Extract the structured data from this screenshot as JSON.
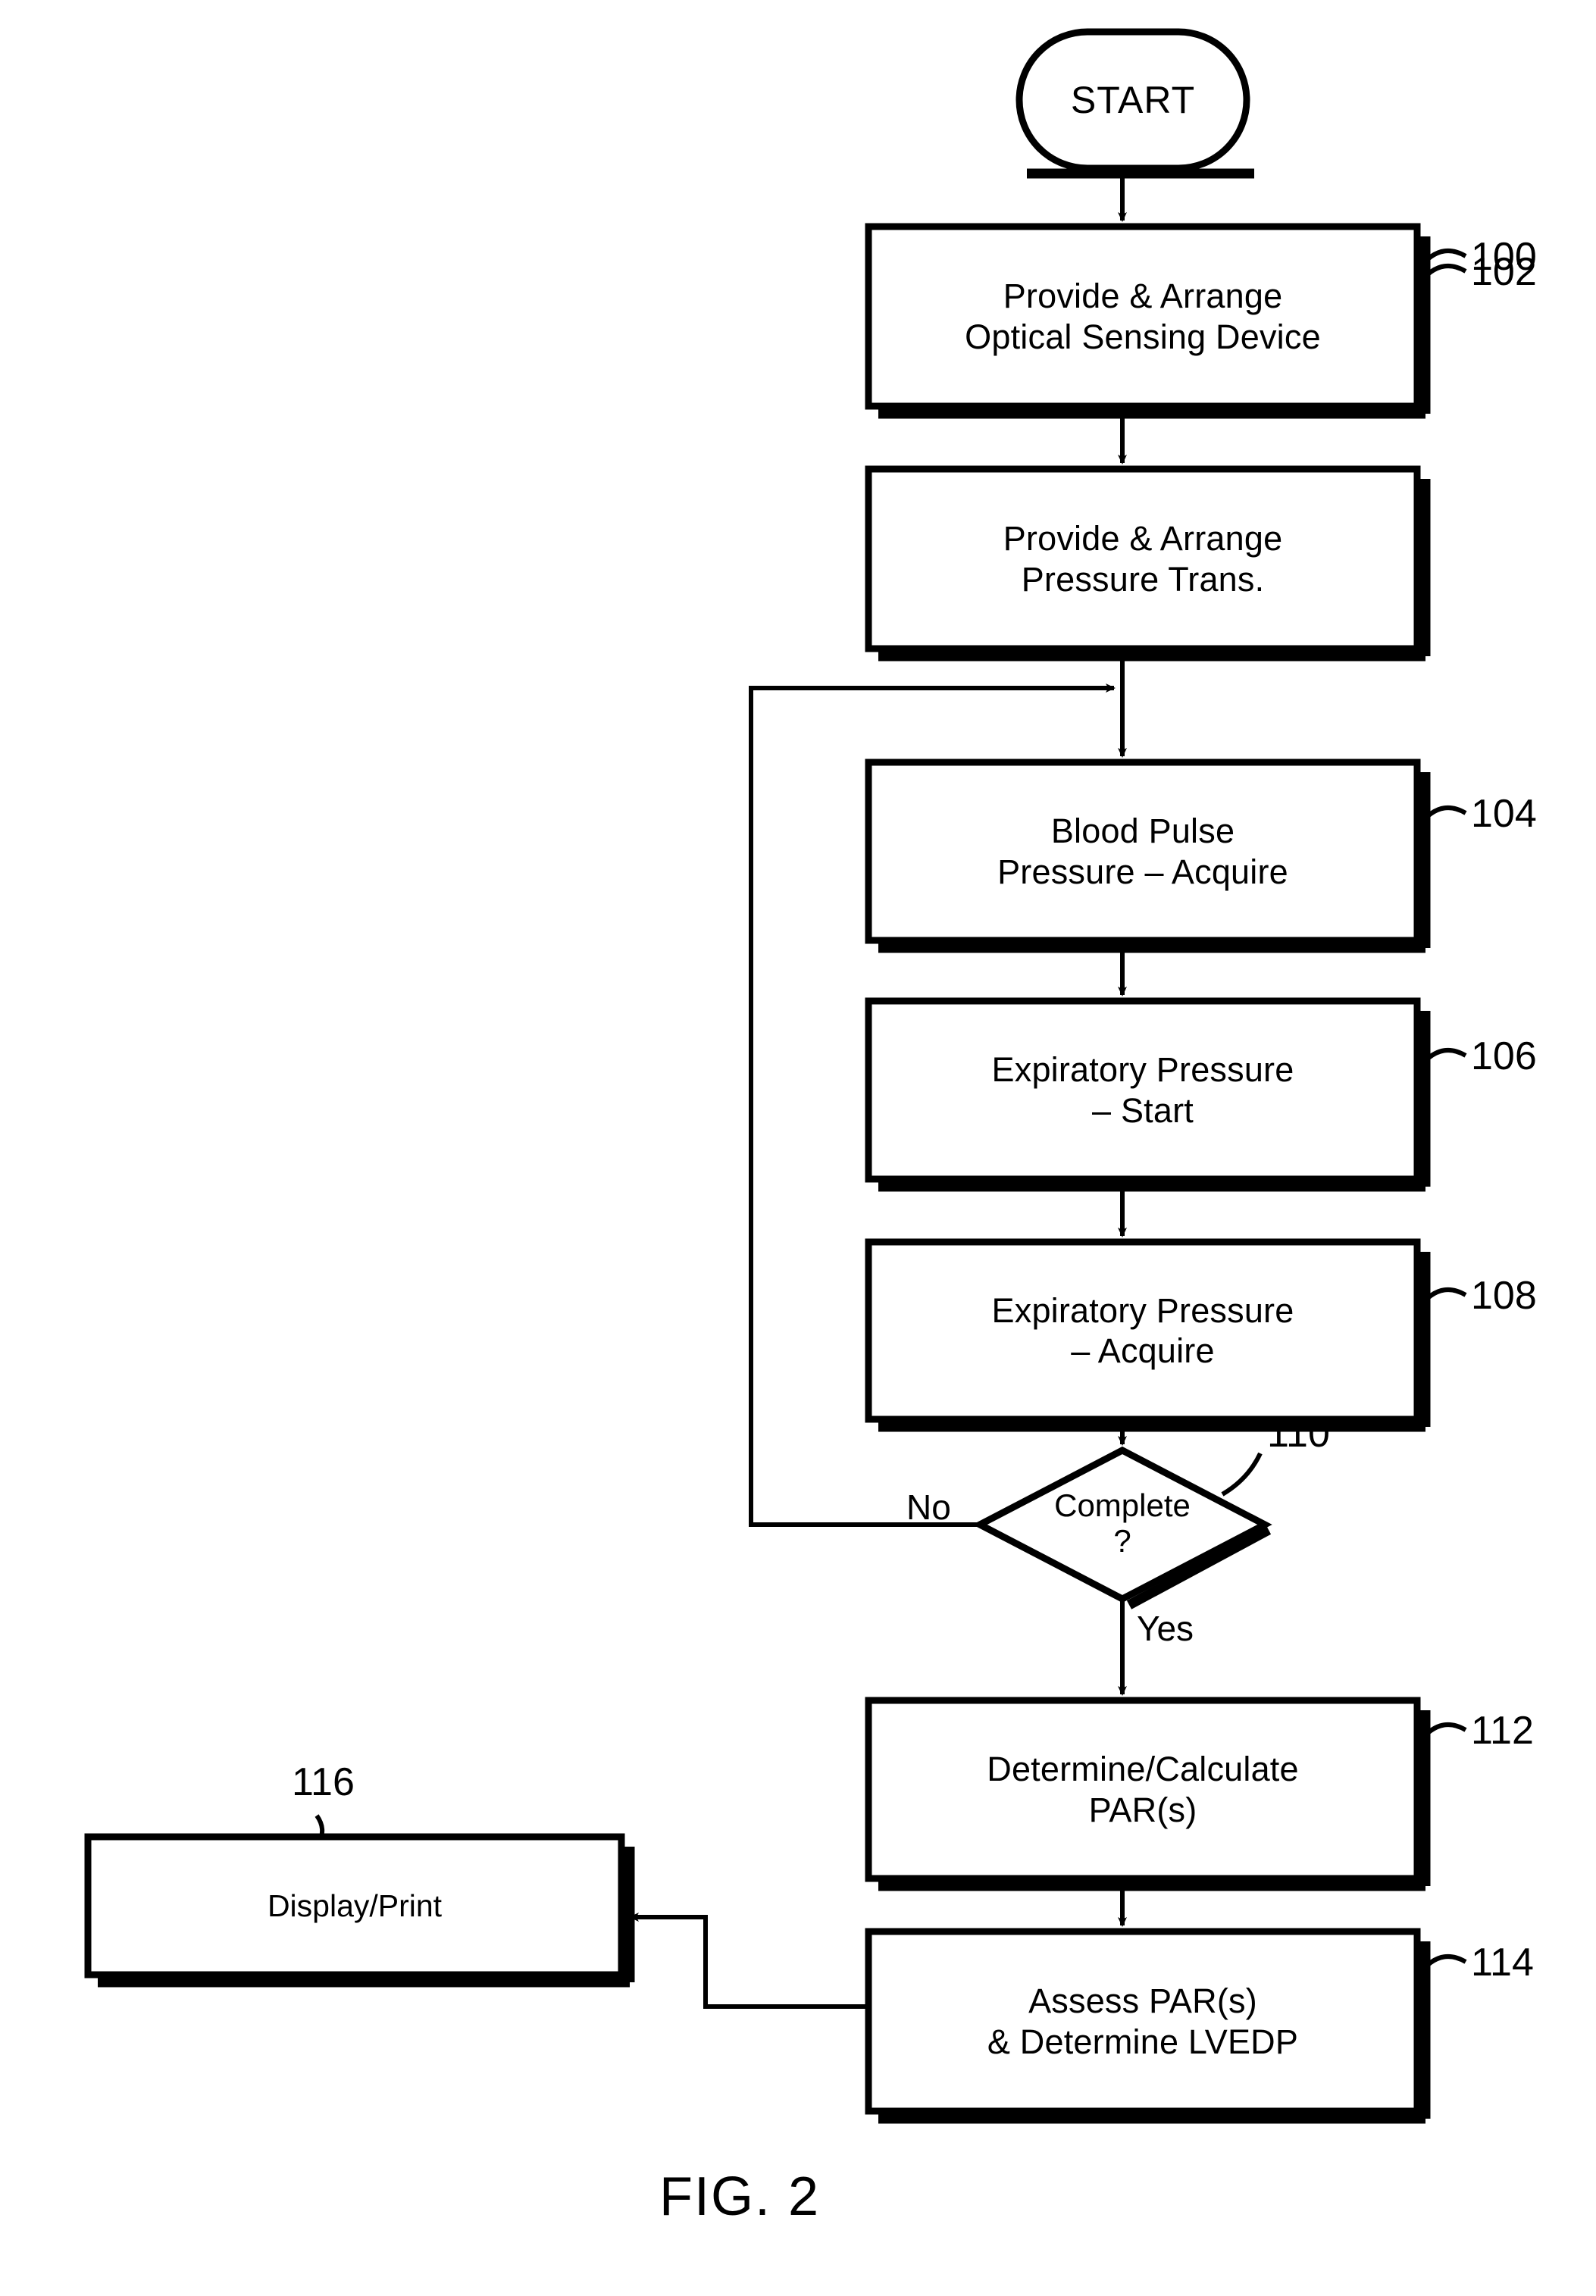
{
  "figure": {
    "caption": "FIG. 2",
    "type": "patent-flowchart"
  },
  "nodes": {
    "start": {
      "shape": "stadium",
      "label": "START"
    },
    "step_100": {
      "shape": "process",
      "ref": "100",
      "line1": "Provide & Arrange",
      "line2": "Optical Sensing Device"
    },
    "step_102": {
      "shape": "process",
      "ref": "102",
      "line1": "Provide & Arrange",
      "line2": "Pressure Trans."
    },
    "step_104": {
      "shape": "process",
      "ref": "104",
      "line1": "Blood Pulse",
      "line2": "Pressure – Acquire"
    },
    "step_106": {
      "shape": "process",
      "ref": "106",
      "line1": "Expiratory Pressure",
      "line2": "– Start"
    },
    "step_108": {
      "shape": "process",
      "ref": "108",
      "line1": "Expiratory Pressure",
      "line2": "– Acquire"
    },
    "decision_110": {
      "shape": "diamond",
      "ref": "110",
      "line1": "Complete",
      "line2": "?",
      "branch_no": "No",
      "branch_yes": "Yes"
    },
    "step_112": {
      "shape": "process",
      "ref": "112",
      "line1": "Determine/Calculate",
      "line2": "PAR(s)"
    },
    "step_114": {
      "shape": "process",
      "ref": "114",
      "line1": "Assess PAR(s)",
      "line2": "& Determine LVEDP"
    },
    "step_116": {
      "shape": "process",
      "ref": "116",
      "line1": "Display/Print"
    }
  },
  "colors": {
    "stroke": "#000000",
    "fill": "#ffffff",
    "text": "#000000"
  }
}
